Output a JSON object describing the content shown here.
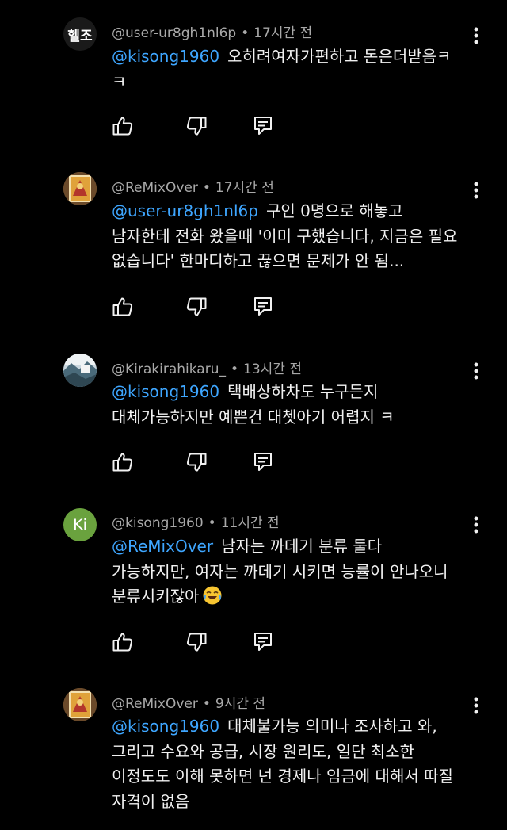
{
  "comments": [
    {
      "avatar": {
        "type": "text",
        "text": "헬조",
        "bg": "#1a1a1a"
      },
      "user": "@user-ur8gh1nl6p",
      "time": "17시간 전",
      "mention": "@kisong1960",
      "lines": [
        "오히려여자가편하고 돈은더받음ㅋ",
        "ㅋ"
      ]
    },
    {
      "avatar": {
        "type": "image",
        "name": "tarot-card-avatar"
      },
      "user": "@ReMixOver",
      "time": "17시간 전",
      "mention": "@user-ur8gh1nl6p",
      "lines": [
        "구인 0명으로 해놓고",
        "남자한테 전화 왔을때 '이미 구했습니다, 지금은 필요",
        "없습니다' 한마디하고 끊으면 문제가 안 됨..."
      ]
    },
    {
      "avatar": {
        "type": "image",
        "name": "landscape-photo-avatar"
      },
      "user": "@Kirakirahikaru_",
      "time": "13시간 전",
      "mention": "@kisong1960",
      "lines": [
        "택배상하차도 누구든지",
        "대체가능하지만 예쁜건 대쳇아기 어렵지 ㅋ"
      ]
    },
    {
      "avatar": {
        "type": "text",
        "text": "Ki",
        "bg": "#6aa23e"
      },
      "user": "@kisong1960",
      "time": "11시간 전",
      "mention": "@ReMixOver",
      "lines": [
        "남자는 까데기 분류 둘다",
        "가능하지만, 여자는 까데기 시키면 능률이 안나오니",
        "분류시키잖아"
      ],
      "emoji": "face-with-tears-of-joy"
    },
    {
      "avatar": {
        "type": "image",
        "name": "tarot-card-avatar"
      },
      "user": "@ReMixOver",
      "time": "9시간 전",
      "mention": "@kisong1960",
      "lines": [
        "대체불가능 의미나 조사하고 와,",
        "그리고 수요와 공급, 시장 원리도, 일단 최소한",
        "이정도도 이해 못하면 넌 경제나 임금에 대해서 따질",
        "자격이 없음"
      ]
    }
  ],
  "icons": {
    "like": "thumb-up-icon",
    "dislike": "thumb-down-icon",
    "reply": "reply-icon",
    "menu": "more-vertical-icon"
  },
  "colors": {
    "background": "#000000",
    "text": "#f1f1f1",
    "meta": "#a9a9a9",
    "mention": "#3ea6ff"
  }
}
